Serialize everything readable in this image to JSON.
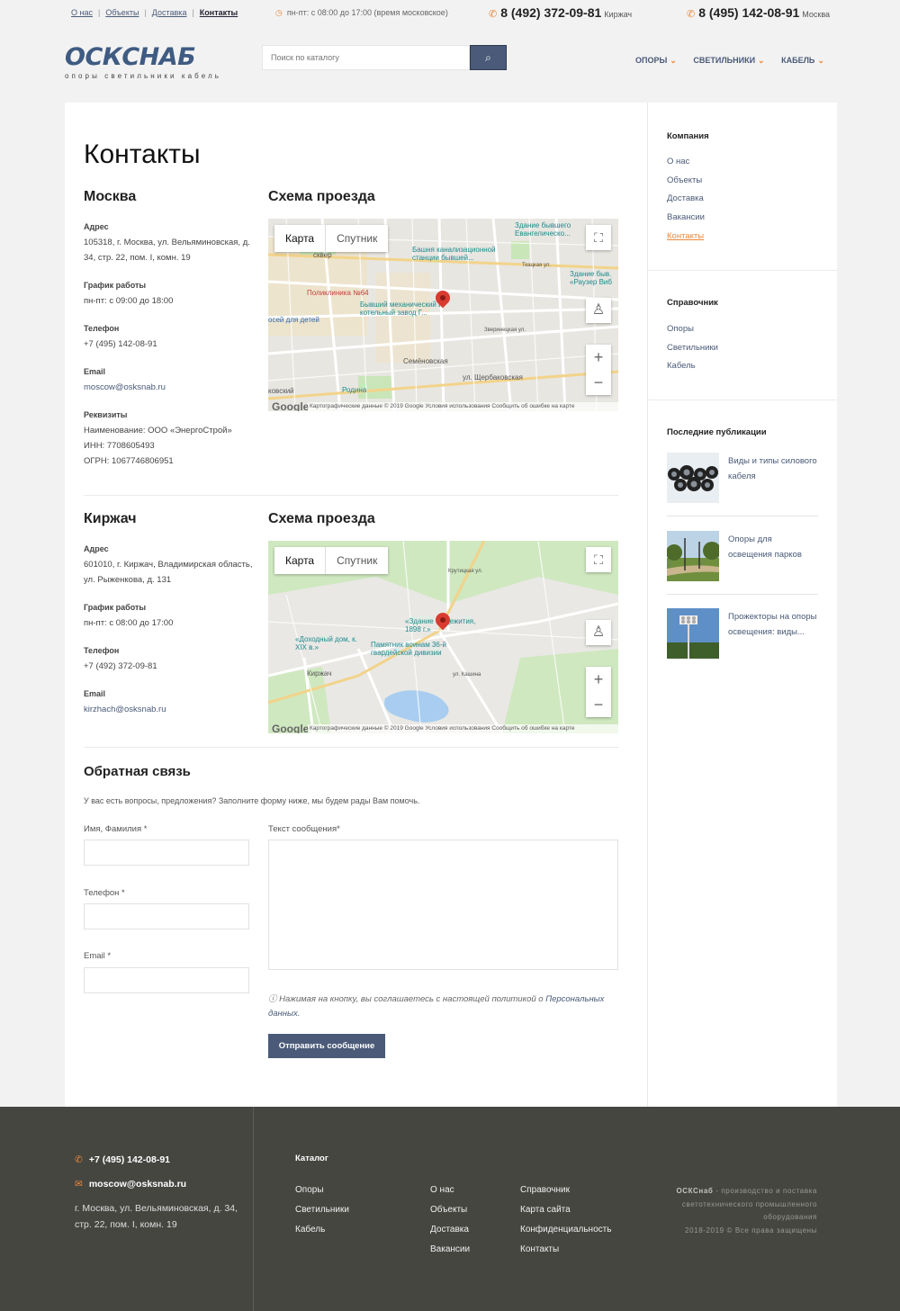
{
  "topbar": {
    "links": [
      {
        "label": "О нас"
      },
      {
        "label": "Объекты"
      },
      {
        "label": "Доставка"
      },
      {
        "label": "Контакты"
      }
    ],
    "hours": "пн-пт: с 08:00 до 17:00 (время московское)",
    "phones": [
      {
        "number": "8 (492) 372-09-81",
        "city": "Киржач"
      },
      {
        "number": "8 (495) 142-08-91",
        "city": "Москва"
      }
    ],
    "icons": {
      "clock": "clock-icon",
      "phone": "phone-icon"
    }
  },
  "header": {
    "logo_text": "ОСКСНАБ",
    "logo_tagline": "опоры светильники кабель",
    "search_placeholder": "Поиск по каталогу",
    "nav": [
      {
        "label": "ОПОРЫ"
      },
      {
        "label": "СВЕТИЛЬНИКИ"
      },
      {
        "label": "КАБЕЛЬ"
      }
    ]
  },
  "main": {
    "title": "Контакты",
    "offices": [
      {
        "city": "Москва",
        "scheme_title": "Схема проезда",
        "address_label": "Адрес",
        "address": "105318, г. Москва, ул. Вельяминовская, д. 34, стр. 22, пом. I, комн. 19",
        "hours_label": "График работы",
        "hours": "пн-пт: с 09:00 до 18:00",
        "phone_label": "Телефон",
        "phone": "+7 (495) 142-08-91",
        "email_label": "Email",
        "email": "moscow@osksnab.ru",
        "requisites_label": "Реквизиты",
        "requisites": [
          "Наименование: ООО «ЭнергоСтрой»",
          "ИНН: 7708605493",
          "ОГРН: 1067746806951"
        ],
        "map": {
          "tab_map": "Карта",
          "tab_satellite": "Спутник",
          "attribution": "Картографические данные © 2019 Google    Условия использования    Сообщить об ошибке на карте",
          "google": "Google",
          "labels": {
            "l1": "Здание бывшего Евангелическо...",
            "l2": "Башня канализационной станции бывшей...",
            "l3": "сквер",
            "l4": "Здание быв. «Раузер Виб",
            "l5": "Поликлиника №64",
            "l6": "Бывший механический и котельный завод Г...",
            "l7": "осей для детей",
            "l8": "Семёновская",
            "l9": "ул. Щербаковская",
            "l10": "Родина",
            "l11": "ковский",
            "l12": "Ткацкая ул.",
            "l13": "Зверинецкая ул."
          }
        }
      },
      {
        "city": "Киржач",
        "scheme_title": "Схема проезда",
        "address_label": "Адрес",
        "address": "601010, г. Киржач, Владимирская область, ул. Рыженкова, д. 131",
        "hours_label": "График работы",
        "hours": "пн-пт: с 08:00 до 17:00",
        "phone_label": "Телефон",
        "phone": "+7 (492) 372-09-81",
        "email_label": "Email",
        "email": "kirzhach@osksnab.ru",
        "map": {
          "tab_map": "Карта",
          "tab_satellite": "Спутник",
          "attribution": "Картографические данные © 2019 Google    Условия использования    Сообщить об ошибке на карте",
          "google": "Google",
          "labels": {
            "l1": "«Здание общежития, 1898 г.»",
            "l2": "«Доходный дом, к. XIX в.»",
            "l3": "Памятник воинам 36-й гвардейской дивизии",
            "l4": "Киржач",
            "l5": "ул. Кашина",
            "l6": "Крутицкая ул."
          }
        }
      }
    ],
    "feedback": {
      "title": "Обратная связь",
      "intro": "У вас есть вопросы, предложения? Заполните форму ниже, мы будем рады Вам помочь.",
      "name_label": "Имя, Фамилия *",
      "phone_label": "Телефон *",
      "email_label": "Email *",
      "message_label": "Текст сообщения*",
      "note_prefix": "Нажимая на кнопку, вы соглашаетесь с настоящей политикой о",
      "note_link": "Персональных данных.",
      "submit": "Отправить сообщение"
    }
  },
  "sidebar": {
    "company_title": "Компания",
    "company_links": [
      {
        "label": "О нас"
      },
      {
        "label": "Объекты"
      },
      {
        "label": "Доставка"
      },
      {
        "label": "Вакансии"
      },
      {
        "label": "Контакты",
        "active": true
      }
    ],
    "ref_title": "Справочник",
    "ref_links": [
      {
        "label": "Опоры"
      },
      {
        "label": "Светильники"
      },
      {
        "label": "Кабель"
      }
    ],
    "posts_title": "Последние публикации",
    "posts": [
      {
        "title": "Виды и типы силового кабеля"
      },
      {
        "title": "Опоры для освещения парков"
      },
      {
        "title": "Прожекторы на опоры освещения: виды..."
      }
    ]
  },
  "footer": {
    "phone": "+7 (495) 142-08-91",
    "email": "moscow@osksnab.ru",
    "address": "г. Москва, ул. Вельяминовская, д. 34, стр. 22, пом. I, комн. 19",
    "catalog_title": "Каталог",
    "col1": [
      "Опоры",
      "Светильники",
      "Кабель"
    ],
    "col2": [
      "О нас",
      "Объекты",
      "Доставка",
      "Вакансии"
    ],
    "col3": [
      "Справочник",
      "Карта сайта",
      "Конфиденциальность",
      "Контакты"
    ],
    "brand": "ОСКСнаб",
    "description": "- производство и поставка светотехнического промышленного оборудования",
    "copyright": "2018-2019 © Все права защищены"
  },
  "colors": {
    "accent": "#e9883a",
    "primary": "#4a5a78",
    "footer": "#464641"
  }
}
